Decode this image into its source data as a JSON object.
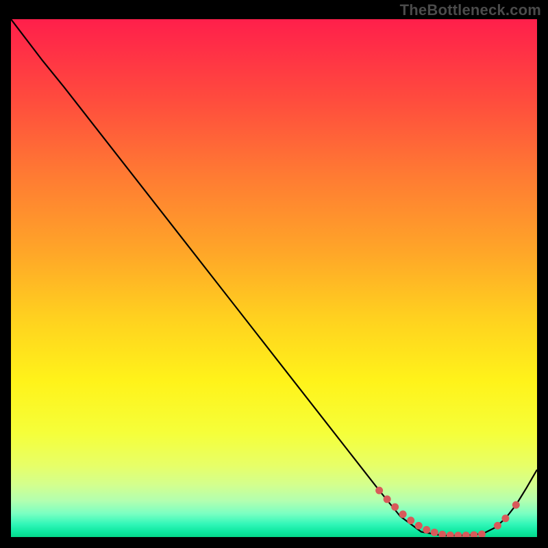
{
  "watermark": "TheBottleneck.com",
  "chart_data": {
    "type": "line",
    "title": "",
    "xlabel": "",
    "ylabel": "",
    "xlim": [
      0,
      100
    ],
    "ylim": [
      0,
      100
    ],
    "grid": false,
    "series": [
      {
        "name": "curve",
        "x": [
          0,
          6,
          10,
          15,
          20,
          25,
          30,
          35,
          40,
          45,
          50,
          55,
          60,
          65,
          70,
          74,
          78,
          82,
          85,
          88,
          90,
          92,
          94,
          96,
          98,
          100
        ],
        "y": [
          100,
          92,
          87,
          80.5,
          74,
          67.5,
          61,
          54.5,
          48,
          41.5,
          35,
          28.5,
          22,
          15.5,
          9,
          4,
          1,
          0.3,
          0.3,
          0.4,
          0.8,
          1.8,
          3.6,
          6.2,
          9.5,
          13
        ]
      }
    ],
    "markers": {
      "name": "highlight-dots",
      "x": [
        70,
        71.5,
        73,
        74.5,
        76,
        77.5,
        79,
        80.5,
        82,
        83.5,
        85,
        86.5,
        88,
        89.5,
        92.5,
        94,
        96
      ],
      "y": [
        9,
        7.3,
        5.8,
        4.4,
        3.2,
        2.2,
        1.4,
        0.9,
        0.5,
        0.35,
        0.3,
        0.32,
        0.4,
        0.55,
        2.2,
        3.6,
        6.2
      ]
    },
    "gradient_stops": [
      {
        "offset": 0,
        "color": "#ff1f4b"
      },
      {
        "offset": 0.15,
        "color": "#ff4a3e"
      },
      {
        "offset": 0.3,
        "color": "#ff7a33"
      },
      {
        "offset": 0.45,
        "color": "#ffa628"
      },
      {
        "offset": 0.58,
        "color": "#ffd21f"
      },
      {
        "offset": 0.7,
        "color": "#fff31a"
      },
      {
        "offset": 0.8,
        "color": "#f5ff3a"
      },
      {
        "offset": 0.86,
        "color": "#e8ff66"
      },
      {
        "offset": 0.9,
        "color": "#d3ff8f"
      },
      {
        "offset": 0.93,
        "color": "#b2ffb0"
      },
      {
        "offset": 0.955,
        "color": "#79ffc2"
      },
      {
        "offset": 0.975,
        "color": "#32f7b8"
      },
      {
        "offset": 0.99,
        "color": "#0de8a0"
      },
      {
        "offset": 1.0,
        "color": "#05d98a"
      }
    ],
    "colors": {
      "marker": "#d85a5a",
      "curve": "#000000"
    }
  }
}
